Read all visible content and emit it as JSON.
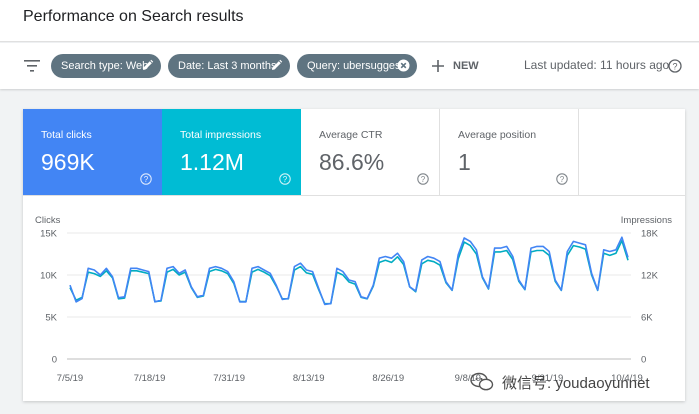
{
  "header": {
    "title": "Performance on Search results"
  },
  "filters": {
    "chips": [
      {
        "label": "Search type: Web",
        "action": "edit"
      },
      {
        "label": "Date: Last 3 months",
        "action": "edit"
      },
      {
        "label": "Query: ubersuggest",
        "action": "remove"
      }
    ],
    "new_label": "NEW",
    "last_updated": "Last updated: 11 hours ago"
  },
  "metrics": [
    {
      "label": "Total clicks",
      "value": "969K",
      "color": "#4285f4"
    },
    {
      "label": "Total impressions",
      "value": "1.12M",
      "color": "#00bcd4"
    },
    {
      "label": "Average CTR",
      "value": "86.6%"
    },
    {
      "label": "Average position",
      "value": "1"
    }
  ],
  "chart_data": {
    "type": "line",
    "left_axis": {
      "label": "Clicks",
      "ticks": [
        "15K",
        "10K",
        "5K",
        "0"
      ],
      "ylim": [
        0,
        15000
      ]
    },
    "right_axis": {
      "label": "Impressions",
      "ticks": [
        "18K",
        "12K",
        "6K",
        "0"
      ],
      "ylim": [
        0,
        18000
      ]
    },
    "x_ticks": [
      "7/5/19",
      "7/18/19",
      "7/31/19",
      "8/13/19",
      "8/26/19",
      "9/8/19",
      "9/21/19",
      "10/4/19"
    ],
    "grid": true,
    "series": [
      {
        "name": "Clicks",
        "color": "#4285f4",
        "values": [
          8800,
          6800,
          7200,
          10800,
          10600,
          10000,
          10800,
          9800,
          7300,
          7400,
          10800,
          10800,
          10600,
          10400,
          6800,
          7000,
          10800,
          11000,
          10200,
          10600,
          8600,
          7400,
          7600,
          10800,
          11000,
          10800,
          10400,
          9200,
          6800,
          6800,
          10800,
          11000,
          10600,
          10200,
          8800,
          7100,
          7200,
          11000,
          11400,
          10600,
          10400,
          8400,
          6500,
          6600,
          10800,
          10400,
          9400,
          9200,
          7400,
          7200,
          8800,
          12000,
          12200,
          12000,
          12600,
          11600,
          8600,
          8100,
          11800,
          12200,
          12000,
          11600,
          9200,
          8200,
          12400,
          14400,
          14000,
          13000,
          9800,
          8400,
          13200,
          13200,
          13400,
          12200,
          9400,
          8300,
          13200,
          13400,
          13400,
          12800,
          9400,
          8200,
          12800,
          14000,
          13800,
          13600,
          10200,
          8200,
          13000,
          12800,
          13000,
          14500,
          12100
        ]
      },
      {
        "name": "Impressions",
        "color": "#00acc1",
        "values": [
          10200,
          8400,
          8800,
          12400,
          12200,
          11800,
          12600,
          11600,
          8600,
          8700,
          12600,
          12600,
          12400,
          12200,
          8200,
          8300,
          12400,
          12800,
          12000,
          12400,
          10200,
          8800,
          9000,
          12500,
          12800,
          12600,
          12200,
          10800,
          8200,
          8200,
          12400,
          12800,
          12400,
          11900,
          10400,
          8600,
          8600,
          12700,
          13200,
          12300,
          12100,
          9900,
          7900,
          7900,
          12400,
          12000,
          11000,
          10700,
          8800,
          8600,
          10400,
          13800,
          14100,
          13800,
          14600,
          13500,
          10300,
          9600,
          13600,
          14100,
          13900,
          13400,
          10900,
          9800,
          14300,
          16700,
          16200,
          15000,
          11600,
          10000,
          15300,
          15300,
          15500,
          14200,
          11100,
          9900,
          15300,
          15500,
          15500,
          14800,
          11100,
          9800,
          14800,
          16200,
          16000,
          15700,
          12000,
          9800,
          15100,
          14800,
          15100,
          16900,
          14100
        ]
      }
    ]
  },
  "watermark": {
    "text": "微信号: youdaoyunnet"
  }
}
